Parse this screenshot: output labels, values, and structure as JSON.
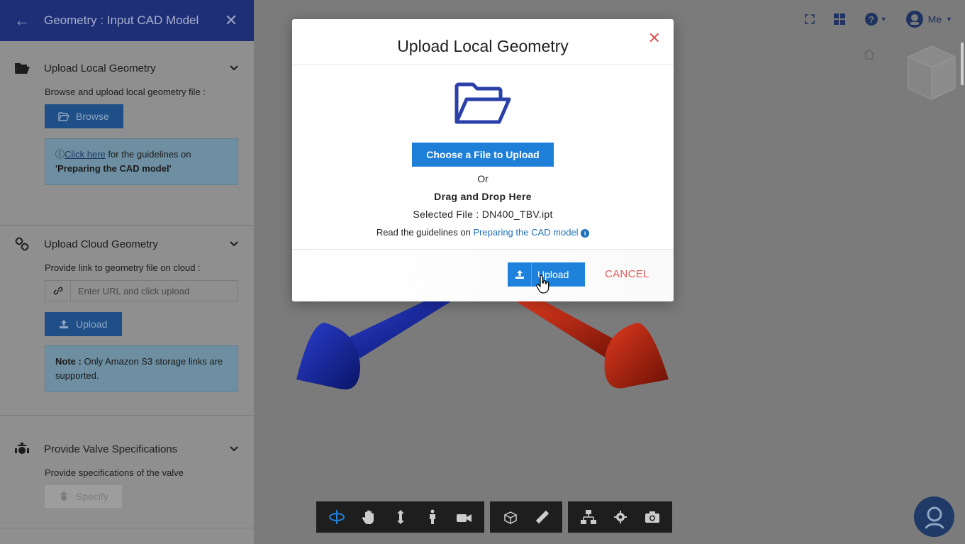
{
  "sidebar": {
    "header_title": "Geometry : Input CAD Model",
    "local": {
      "title": "Upload Local Geometry",
      "label": "Browse and upload local geometry file :",
      "browse_label": "Browse",
      "note_link": "Click here",
      "note_text": " for the guidelines on",
      "note_bold": "'Preparing the CAD model'"
    },
    "cloud": {
      "title": "Upload Cloud Geometry",
      "label": "Provide link to geometry file on cloud :",
      "url_placeholder": "Enter URL and click upload",
      "upload_label": "Upload",
      "note_bold": "Note :",
      "note_text": " Only Amazon S3 storage links are supported."
    },
    "valve": {
      "title": "Provide Valve Specifications",
      "label": "Provide specifications of the valve",
      "specify_label": "Specify"
    }
  },
  "topbar": {
    "me_label": "Me"
  },
  "modal": {
    "title": "Upload Local Geometry",
    "choose_label": "Choose a File to Upload",
    "or_text": "Or",
    "drag_text": "Drag and Drop Here",
    "selected_label": "Selected File : ",
    "selected_file": "DN400_TBV.ipt",
    "guide_text": "Read the guidelines on ",
    "guide_link": "Preparing the CAD model",
    "upload_label": "Upload",
    "cancel_label": "CANCEL"
  },
  "colors": {
    "header_bg": "#1f2f76",
    "primary": "#1e7fd8",
    "danger": "#e05a5a",
    "arrow_blue": "#1a2aa0",
    "arrow_red": "#b22010"
  }
}
